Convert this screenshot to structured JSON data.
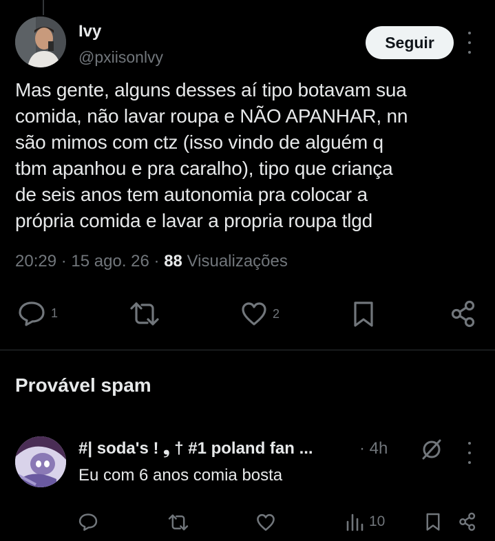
{
  "tweet": {
    "author_name": "Ivy",
    "author_handle": "@pxiisonlvy",
    "follow_label": "Seguir",
    "text": "Mas gente, alguns desses aí tipo botavam sua\ncomida, não lavar roupa e NÃO APANHAR, nn\nsão mimos com ctz (isso vindo de alguém q\ntbm apanhou e pra caralho), tipo que criança\nde seis anos tem autonomia pra colocar a\nprópria comida e lavar a propria roupa tlgd",
    "time": "20:29",
    "date": "15 ago. 26",
    "views_count": "88",
    "views_label": "Visualizações",
    "reply_count": "1",
    "like_count": "2"
  },
  "section": {
    "title": "Provável spam"
  },
  "reply": {
    "author_name": "#| soda's ! ❟ † #1 poland fan ...",
    "time": "· 4h",
    "text": "Eu com 6 anos comia bosta",
    "views_count": "10"
  },
  "colors": {
    "background": "#000000",
    "text": "#e7e9ea",
    "muted": "#71767b",
    "divider": "#2f3336",
    "button_bg": "#eff3f4"
  }
}
